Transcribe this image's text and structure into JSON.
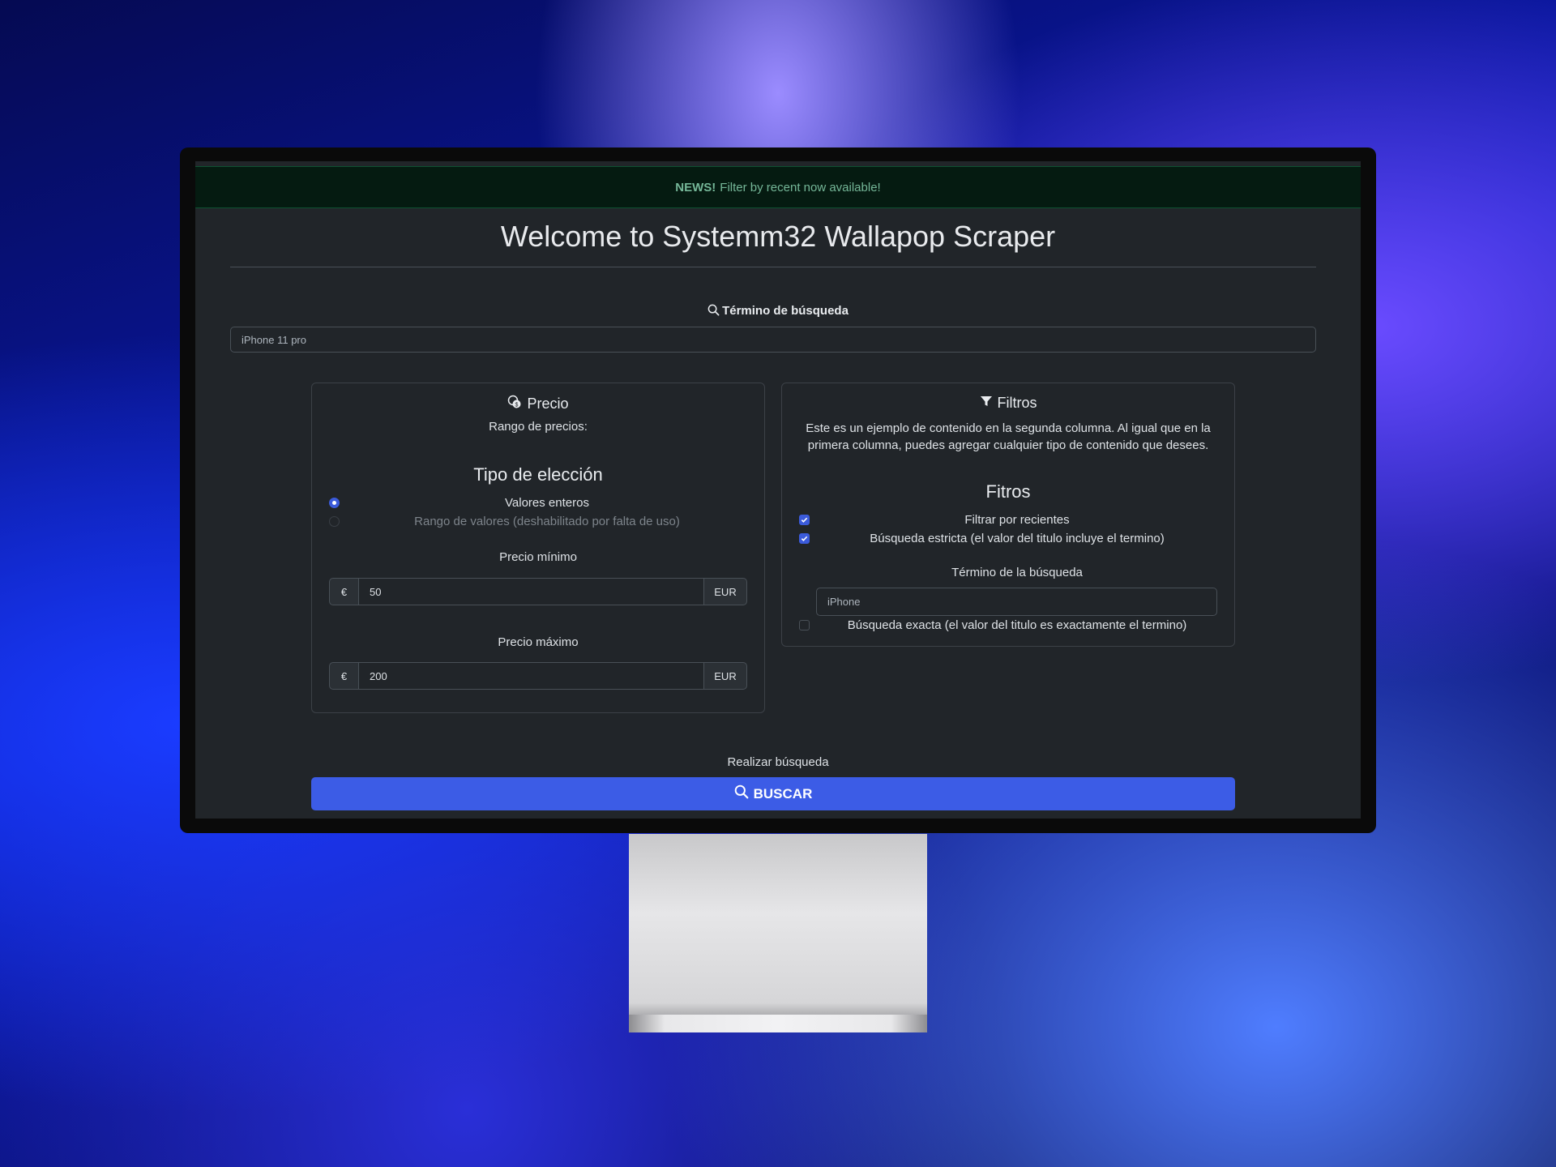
{
  "news": {
    "badge": "NEWS!",
    "text": "Filter by recent now available!"
  },
  "page_title": "Welcome to Systemm32 Wallapop Scraper",
  "search": {
    "label": "Término de búsqueda",
    "value": "iPhone 11 pro"
  },
  "price_card": {
    "title": "Precio",
    "subtitle": "Rango de precios:",
    "choice_heading": "Tipo de elección",
    "options": [
      {
        "label": "Valores enteros",
        "selected": true,
        "disabled": false
      },
      {
        "label": "Rango de valores (deshabilitado por falta de uso)",
        "selected": false,
        "disabled": true
      }
    ],
    "min_label": "Precio mínimo",
    "min_prefix": "€",
    "min_value": "50",
    "min_suffix": "EUR",
    "max_label": "Precio máximo",
    "max_prefix": "€",
    "max_value": "200",
    "max_suffix": "EUR"
  },
  "filters_card": {
    "title": "Filtros",
    "description_line1": "Este es un ejemplo de contenido en la segunda columna. Al igual que en la",
    "description_line2": "primera columna, puedes agregar cualquier tipo de contenido que desees.",
    "heading": "Fitros",
    "checks": [
      {
        "label": "Filtrar por recientes",
        "checked": true
      },
      {
        "label": "Búsqueda estricta (el valor del titulo incluye el termino)",
        "checked": true
      }
    ],
    "term_label": "Término de la búsqueda",
    "term_value": "iPhone",
    "exact_label": "Búsqueda exacta (el valor del titulo es exactamente el termino)",
    "exact_checked": false
  },
  "submit": {
    "label": "Realizar búsqueda",
    "button": "BUSCAR"
  },
  "colors": {
    "accent": "#3c5ce6",
    "background": "#212529",
    "news_bg": "#051b11",
    "news_text": "#75b798"
  }
}
